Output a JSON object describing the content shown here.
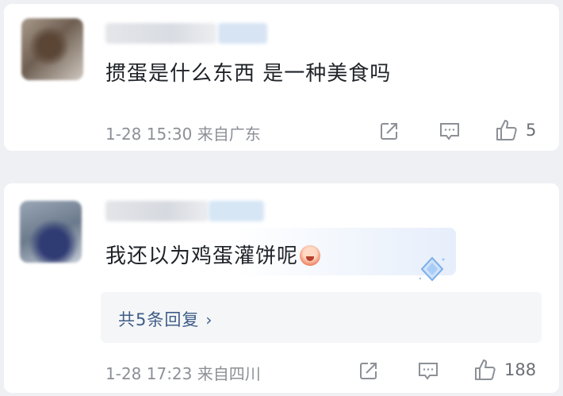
{
  "comments": [
    {
      "text": "掼蛋是什么东西 是一种美食吗",
      "timestamp": "1-28 15:30",
      "location": "来自广东",
      "like_count": "5",
      "icons": {
        "share": "share-icon",
        "reply": "comment-icon",
        "like": "thumbs-up-icon"
      }
    },
    {
      "text": "我还以为鸡蛋灌饼呢",
      "timestamp": "1-28 17:23",
      "location": "来自四川",
      "like_count": "188",
      "reply_summary": "共5条回复",
      "reply_chevron": "›",
      "icons": {
        "share": "share-icon",
        "reply": "comment-icon",
        "like": "thumbs-up-icon"
      }
    }
  ],
  "colors": {
    "background": "#eef0f3",
    "card": "#ffffff",
    "text": "#1f2328",
    "meta": "#8c9096",
    "reply_link": "#3e5d86",
    "reply_box": "#f5f6f8"
  }
}
